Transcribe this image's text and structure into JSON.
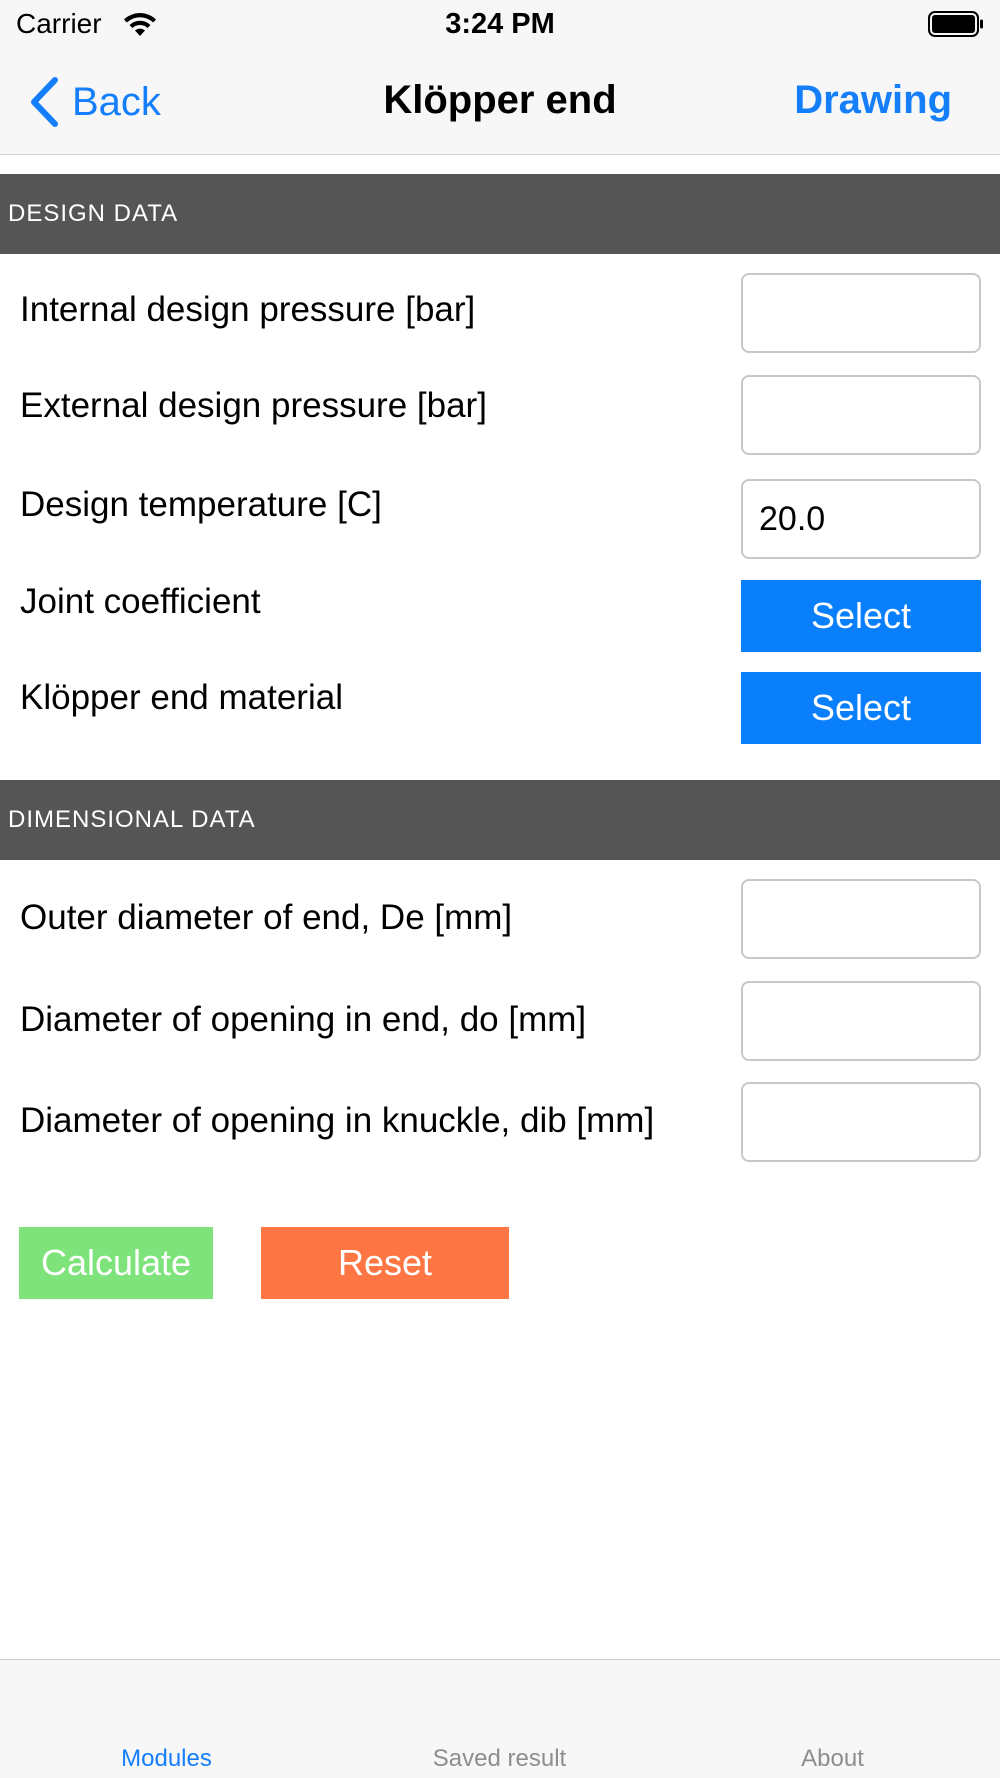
{
  "status_bar": {
    "carrier": "Carrier",
    "time": "3:24 PM"
  },
  "nav": {
    "back_label": "Back",
    "title": "Klöpper end",
    "drawing_label": "Drawing"
  },
  "design_section": {
    "header": "DESIGN DATA",
    "internal_pressure": {
      "label": "Internal design pressure [bar]",
      "value": ""
    },
    "external_pressure": {
      "label": "External design pressure [bar]",
      "value": ""
    },
    "temperature": {
      "label": "Design temperature [C]",
      "value": "20.0"
    },
    "joint_coefficient": {
      "label": "Joint coefficient",
      "button": "Select"
    },
    "material": {
      "label": "Klöpper end material",
      "button": "Select"
    }
  },
  "dimensional_section": {
    "header": "DIMENSIONAL DATA",
    "outer_diameter": {
      "label": "Outer diameter of end, De [mm]",
      "value": ""
    },
    "opening_end": {
      "label": "Diameter of opening in end, do [mm]",
      "value": ""
    },
    "opening_knuckle": {
      "label": "Diameter of opening in knuckle, dib [mm]",
      "value": ""
    }
  },
  "actions": {
    "calculate": "Calculate",
    "reset": "Reset"
  },
  "tabs": [
    {
      "label": "Modules",
      "active": true
    },
    {
      "label": "Saved result",
      "active": false
    },
    {
      "label": "About",
      "active": false
    }
  ],
  "colors": {
    "accent": "#147efb",
    "section_header": "#555555",
    "select_button": "#0a7ffb",
    "calculate_button": "#7ee37a",
    "reset_button": "#ff7645"
  },
  "icons": {
    "back": "chevron-left-icon",
    "wifi": "wifi-icon",
    "battery": "battery-icon"
  }
}
